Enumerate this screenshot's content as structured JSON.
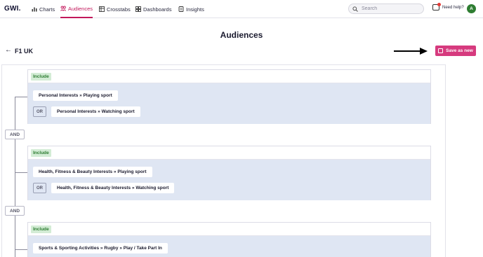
{
  "nav": {
    "logo": "GWI.",
    "items": [
      {
        "label": "Charts",
        "icon": "chart-bar-icon",
        "active": false
      },
      {
        "label": "Audiences",
        "icon": "audiences-icon",
        "active": true
      },
      {
        "label": "Crosstabs",
        "icon": "crosstab-icon",
        "active": false
      },
      {
        "label": "Dashboards",
        "icon": "dashboard-icon",
        "active": false
      },
      {
        "label": "Insights",
        "icon": "insights-icon",
        "active": false
      }
    ],
    "search_placeholder": "Search",
    "help_label": "Need help?",
    "avatar_initial": "A"
  },
  "page": {
    "title": "Audiences",
    "audience_name": "F1 UK",
    "save_button": "Save as new"
  },
  "colors": {
    "accent": "#c2185b",
    "save_button": "#d63a7e",
    "include_badge_bg": "#d3ecd5",
    "include_badge_text": "#2e7d32",
    "group_body": "#dfe6f3",
    "avatar": "#2e7d32"
  },
  "builder": {
    "operator": "AND",
    "groups": [
      {
        "include_label": "Include",
        "items": [
          {
            "label": "Personal Interests » Playing sport"
          },
          {
            "connector": "OR",
            "label": "Personal Interests » Watching sport"
          }
        ]
      },
      {
        "include_label": "Include",
        "items": [
          {
            "label": "Health, Fitness & Beauty Interests » Playing sport"
          },
          {
            "connector": "OR",
            "label": "Health, Fitness & Beauty Interests » Watching sport"
          }
        ]
      },
      {
        "include_label": "Include",
        "items": [
          {
            "label": "Sports & Sporting Activities » Rugby » Play / Take Part In"
          }
        ]
      }
    ]
  }
}
